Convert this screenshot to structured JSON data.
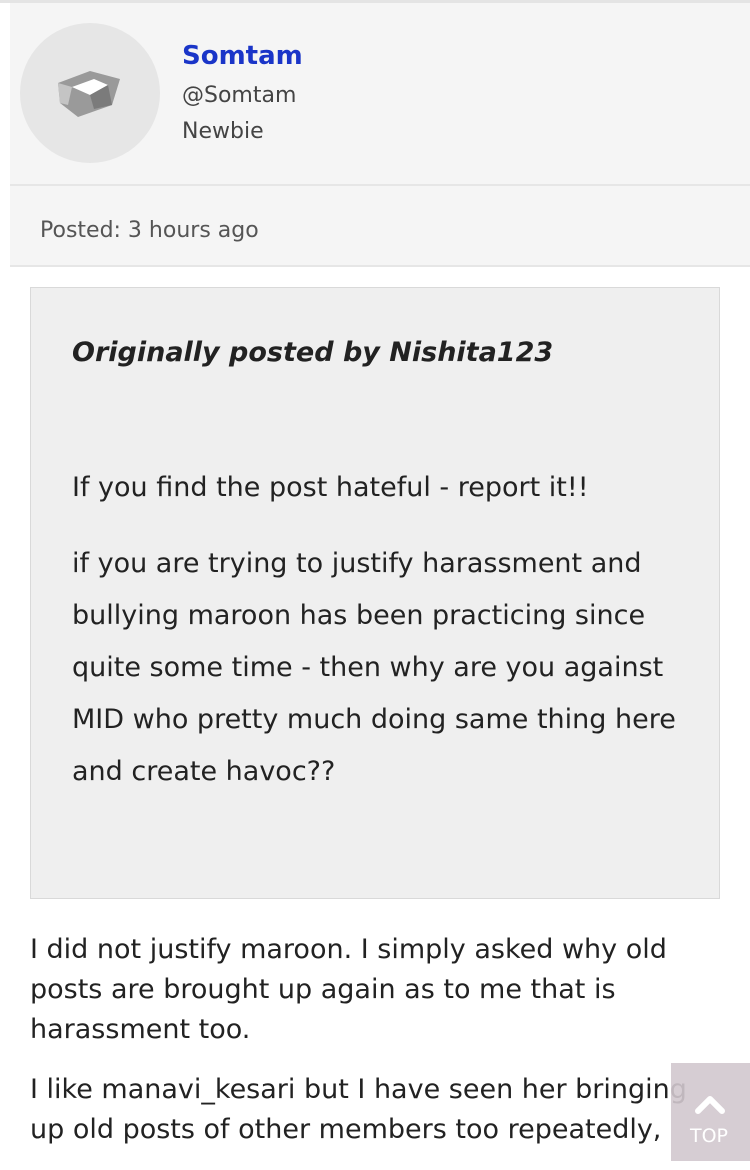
{
  "author": {
    "name": "Somtam",
    "handle": "@Somtam",
    "rank": "Newbie"
  },
  "post": {
    "posted_label": "Posted: 3 hours ago"
  },
  "quote": {
    "header": "Originally posted by Nishita123",
    "paragraph1": "If you find the post hateful - report it!!",
    "paragraph2": "if you are trying to justify harassment and bullying maroon has been practicing since quite some time - then why are you against MID who pretty much doing same thing here and create havoc??"
  },
  "reply": {
    "paragraph1": "I did not justify maroon. I simply asked why old posts are brought up again as to me that is harassment too.",
    "paragraph2": "I like manavi_kesari but I have seen her bringing up old posts of other members too repeatedly,"
  },
  "scroll_top": {
    "label": "TOP",
    "icon": "chevron-up-icon"
  }
}
